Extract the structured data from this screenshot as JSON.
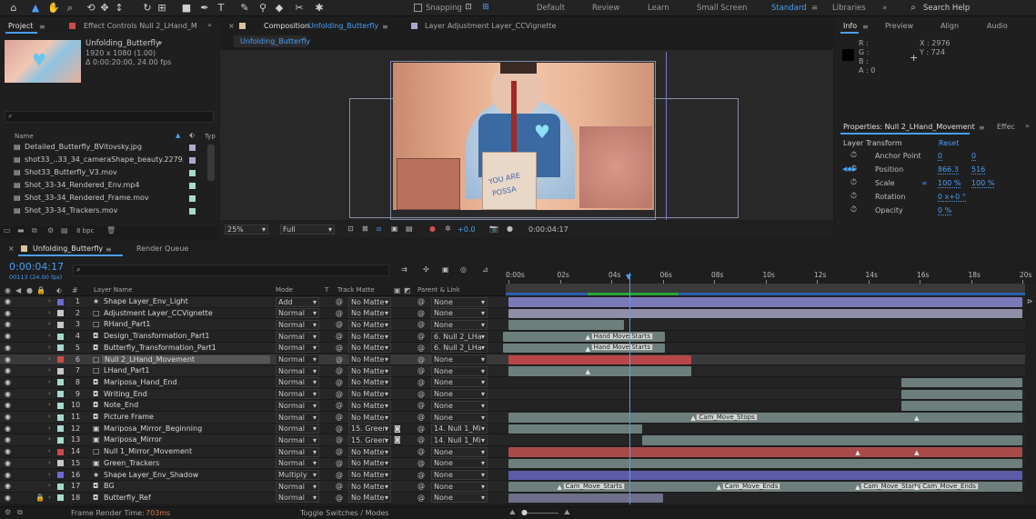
{
  "workspaces": {
    "snapping": "Snapping",
    "items": [
      "Default",
      "Review",
      "Learn",
      "Small Screen",
      "Standard",
      "Libraries"
    ],
    "active": "Standard",
    "search_placeholder": "Search Help"
  },
  "project": {
    "tab_project": "Project",
    "tab_effects": "Effect Controls Null 2_LHand_M",
    "comp_name": "Unfolding_Butterfly",
    "comp_res": "1920 x 1080 (1.00)",
    "comp_dur": "Δ 0:00:20:00, 24.00 fps",
    "search_value": "",
    "col_name": "Name",
    "col_type": "Typ",
    "files": [
      {
        "name": "Detailed_Butterfly_BVitovsky.jpg",
        "color": "#a9a9cf"
      },
      {
        "name": "shot33_..33_34_cameraShape_beauty.2279.exr",
        "color": "#a9a9cf"
      },
      {
        "name": "Shot33_Butterfly_V3.mov",
        "color": "#a6d9cf"
      },
      {
        "name": "Shot_33-34_Rendered_Env.mp4",
        "color": "#a6d9cf"
      },
      {
        "name": "Shot_33-34_Rendered_Frame.mov",
        "color": "#a6d9cf"
      },
      {
        "name": "Shot_33-34_Trackers.mov",
        "color": "#a6d9cf"
      }
    ],
    "bpc": "8 bpc"
  },
  "composition": {
    "tab_comp_prefix": "Composition",
    "tab_comp_name": "Unfolding_Butterfly",
    "tab_layer": "Layer  Adjustment Layer_CCVignette",
    "breadcrumb": "Unfolding_Butterfly",
    "zoom": "25%",
    "quality": "Full",
    "exposure": "+0.0",
    "timecode": "0:00:04:17",
    "sign_line1": "YOU ARE",
    "sign_line2": "POSSA"
  },
  "info": {
    "tabs": [
      "Info",
      "Preview",
      "Align",
      "Audio"
    ],
    "r": "R :",
    "g": "G :",
    "b": "B :",
    "a": "A : 0",
    "x": "X : 2976",
    "y": "Y : 724"
  },
  "properties": {
    "title": "Properties: Null 2_LHand_Movement",
    "tab_effects": "Effec",
    "section": "Layer Transform",
    "reset": "Reset",
    "rows": [
      {
        "label": "Anchor Point",
        "v1": "0",
        "v2": "0"
      },
      {
        "label": "Position",
        "v1": "866.3",
        "v2": "516"
      },
      {
        "label": "Scale",
        "v1": "100 %",
        "v2": "100 %"
      },
      {
        "label": "Rotation",
        "v1": "0 x+0 °",
        "v2": ""
      },
      {
        "label": "Opacity",
        "v1": "0 %",
        "v2": ""
      }
    ]
  },
  "timeline": {
    "tab_comp": "Unfolding_Butterfly",
    "tab_render": "Render Queue",
    "current_time": "0:00:04:17",
    "frame_info": "00113 (24.00 fps)",
    "col_layer_name": "Layer Name",
    "col_mode": "Mode",
    "col_t": "T",
    "col_track_matte": "Track Matte",
    "col_parent": "Parent & Link",
    "ruler": [
      "0:00s",
      "02s",
      "04s",
      "06s",
      "08s",
      "10s",
      "12s",
      "14s",
      "16s",
      "18s",
      "20s"
    ],
    "frame_render_label": "Frame Render Time:",
    "frame_render_value": "703ms",
    "toggle_label": "Toggle Switches / Modes",
    "layers": [
      {
        "num": "1",
        "name": "Shape Layer_Env_Light",
        "icon": "★",
        "label": "#6b6bd0",
        "mode": "Add",
        "matte": "No Matte",
        "parent": "None",
        "bar": [
          0,
          20
        ],
        "barColor": "#7a7ab8",
        "hl": false
      },
      {
        "num": "2",
        "name": "Adjustment Layer_CCVignette",
        "icon": "□",
        "label": "#c8c8c8",
        "mode": "Normal",
        "matte": "No Matte",
        "parent": "None",
        "bar": [
          0,
          20
        ],
        "barColor": "#8f8fa8",
        "hl": false
      },
      {
        "num": "3",
        "name": "RHand_Part1",
        "icon": "□",
        "label": "#c8c8c8",
        "mode": "Normal",
        "matte": "No Matte",
        "parent": "None",
        "bar": [
          0,
          4.5
        ],
        "barColor": "#6c7f7c",
        "hl": false
      },
      {
        "num": "4",
        "name": "Design_Transformation_Part1",
        "icon": "◘",
        "label": "#a6d9cf",
        "mode": "Normal",
        "matte": "No Matte",
        "parent": "6. Null 2_LHa",
        "bar": [
          -0.2,
          6.1
        ],
        "barColor": "#6c7f7c",
        "hl": false,
        "markers": [
          {
            "t": 3.1,
            "label": "Hand Move Starts"
          }
        ]
      },
      {
        "num": "5",
        "name": "Butterfly_Transformation_Part1",
        "icon": "◘",
        "label": "#a6d9cf",
        "mode": "Normal",
        "matte": "No Matte",
        "parent": "6. Null 2_LHa",
        "bar": [
          -0.2,
          6.1
        ],
        "barColor": "#6c7f7c",
        "hl": false,
        "markers": [
          {
            "t": 3.1,
            "label": "Hand Move Starts"
          }
        ]
      },
      {
        "num": "6",
        "name": "Null 2_LHand_Movement",
        "icon": "□",
        "label": "#c94b4b",
        "mode": "Normal",
        "matte": "No Matte",
        "parent": "None",
        "bar": [
          0,
          7.1
        ],
        "barColor": "#b84848",
        "hl": true
      },
      {
        "num": "7",
        "name": "LHand_Part1",
        "icon": "□",
        "label": "#c8c8c8",
        "mode": "Normal",
        "matte": "No Matte",
        "parent": "None",
        "bar": [
          0,
          7.1
        ],
        "barColor": "#6c7f7c",
        "hl": false,
        "keys": [
          3.1
        ]
      },
      {
        "num": "8",
        "name": "Mariposa_Hand_End",
        "icon": "◘",
        "label": "#a6d9cf",
        "mode": "Normal",
        "matte": "No Matte",
        "parent": "None",
        "bar": [
          15.3,
          20
        ],
        "barColor": "#6c7f7c",
        "hl": false
      },
      {
        "num": "9",
        "name": "Writing_End",
        "icon": "◘",
        "label": "#a6d9cf",
        "mode": "Normal",
        "matte": "No Matte",
        "parent": "None",
        "bar": [
          15.3,
          20
        ],
        "barColor": "#6c7f7c",
        "hl": false
      },
      {
        "num": "10",
        "name": "Note_End",
        "icon": "◘",
        "label": "#a6d9cf",
        "mode": "Normal",
        "matte": "No Matte",
        "parent": "None",
        "bar": [
          15.3,
          20
        ],
        "barColor": "#6c7f7c",
        "hl": false
      },
      {
        "num": "11",
        "name": "Picture Frame",
        "icon": "◘",
        "label": "#a6d9cf",
        "mode": "Normal",
        "matte": "No Matte",
        "parent": "None",
        "bar": [
          0,
          20
        ],
        "barColor": "#6c7f7c",
        "hl": false,
        "markers": [
          {
            "t": 7.2,
            "label": "Cam_Move_Stops"
          }
        ],
        "keys": [
          15.9
        ]
      },
      {
        "num": "12",
        "name": "Mariposa_Mirror_Beginning",
        "icon": "▣",
        "label": "#a6d9cf",
        "mode": "Normal",
        "matte": "15. Green",
        "parent": "14. Null 1_Mi",
        "bar": [
          0,
          5.2
        ],
        "barColor": "#6c7f7c",
        "hl": false
      },
      {
        "num": "13",
        "name": "Mariposa_Mirror",
        "icon": "▣",
        "label": "#a6d9cf",
        "mode": "Normal",
        "matte": "15. Green",
        "parent": "14. Null 1_Mi",
        "bar": [
          5.2,
          20
        ],
        "barColor": "#6c7f7c",
        "hl": false
      },
      {
        "num": "14",
        "name": "Null 1_Mirror_Movement",
        "icon": "□",
        "label": "#c94b4b",
        "mode": "Normal",
        "matte": "No Matte",
        "parent": "None",
        "bar": [
          0,
          20
        ],
        "barColor": "#a84a4a",
        "hl": false,
        "keys": [
          13.6,
          15.9
        ]
      },
      {
        "num": "15",
        "name": "Green_Trackers",
        "icon": "▣",
        "label": "#c8c8c8",
        "mode": "Normal",
        "matte": "No Matte",
        "parent": "None",
        "bar": [
          0,
          20
        ],
        "barColor": "#6c7f7c",
        "hl": false
      },
      {
        "num": "16",
        "name": "Shape Layer_Env_Shadow",
        "icon": "★",
        "label": "#6b6bd0",
        "mode": "Multiply",
        "matte": "No Matte",
        "parent": "None",
        "bar": [
          0,
          20
        ],
        "barColor": "#5c5ca8",
        "hl": false
      },
      {
        "num": "17",
        "name": "BG",
        "icon": "◘",
        "label": "#a6d9cf",
        "mode": "Normal",
        "matte": "No Matte",
        "parent": "None",
        "bar": [
          0,
          20
        ],
        "barColor": "#6c7f7c",
        "hl": false,
        "markers": [
          {
            "t": 2.0,
            "label": "Cam_Move_Starts"
          },
          {
            "t": 8.2,
            "label": "Cam_Move_Ends"
          },
          {
            "t": 13.6,
            "label": "Cam_Move_Starts"
          },
          {
            "t": 15.9,
            "label": "Cam_Move_Ends"
          }
        ]
      },
      {
        "num": "18",
        "name": "Butterfly_Ref",
        "icon": "◘",
        "label": "#a6d9cf",
        "mode": "Normal",
        "matte": "No Matte",
        "parent": "None",
        "bar": [
          0,
          6
        ],
        "barColor": "#6e6f88",
        "hl": false,
        "locked": true
      }
    ]
  }
}
